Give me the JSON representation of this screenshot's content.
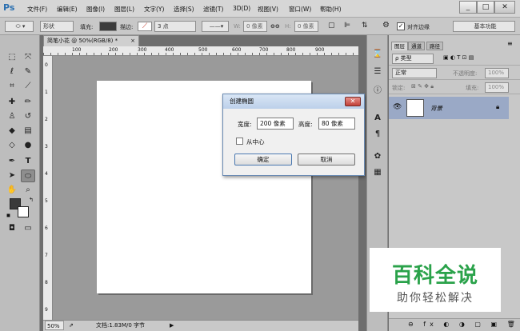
{
  "app": {
    "logo": "Ps"
  },
  "menubar": {
    "items": [
      "文件(F)",
      "编辑(E)",
      "图像(I)",
      "图层(L)",
      "文字(Y)",
      "选择(S)",
      "滤镜(T)",
      "3D(D)",
      "视图(V)",
      "窗口(W)",
      "帮助(H)"
    ],
    "minimize": "_",
    "maximize": "□",
    "close": "✕"
  },
  "options": {
    "shape_mode": "形状",
    "fill_label": "填充:",
    "stroke_label": "描边:",
    "stroke_size": "3 点",
    "width_label": "W:",
    "width_value": "0 像素",
    "link_symbol": "⊖⊖",
    "height_label": "H:",
    "height_value": "0 像素",
    "align_edges_label": "对齐边缘",
    "workspace": "基本功能"
  },
  "document": {
    "tab_title": "简笔小花 @ 50%(RGB/8) *",
    "ruler_marks": [
      "100",
      "200",
      "300",
      "400",
      "500",
      "600",
      "700",
      "800",
      "900"
    ],
    "ruler_left_marks": [
      "0",
      "1",
      "2",
      "3",
      "4",
      "5",
      "6",
      "7",
      "8",
      "9"
    ],
    "zoom": "50%",
    "doc_info": "文档:1.83M/0 字节"
  },
  "dialog": {
    "title": "创建椭圆",
    "width_label": "宽度:",
    "width_value": "200 像素",
    "height_label": "高度:",
    "height_value": "80 像素",
    "from_center": "从中心",
    "ok": "确定",
    "cancel": "取消",
    "close": "✕"
  },
  "layers_panel": {
    "tabs": [
      "图层",
      "通道",
      "路径"
    ],
    "kind_filter": "ρ 类型",
    "blend_mode": "正常",
    "opacity_label": "不透明度:",
    "opacity_value": "100%",
    "lock_label": "锁定:",
    "fill_label": "填充:",
    "fill_value": "100%",
    "layer_name": "背景"
  },
  "watermark": {
    "main": "百科全说",
    "sub": "助你轻松解决"
  },
  "colors": {
    "accent": "#2aa24a",
    "layer_selected": "#9aa9c6",
    "dialog_title": "#bcd0ea"
  }
}
